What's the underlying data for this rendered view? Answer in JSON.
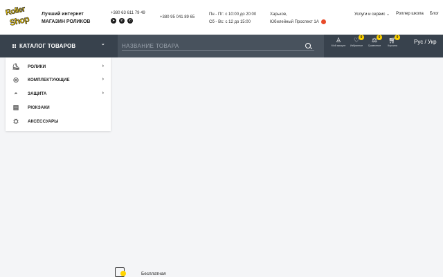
{
  "header": {
    "logo_line1": "Roller",
    "logo_line2": "Shop",
    "tagline_line1": "Лучший интернет",
    "tagline_line2": "МАГАЗИН РОЛИКОВ",
    "phone_primary": "+380 63 611 79 49",
    "phone_secondary": "+380 95 041 89 65",
    "hours_weekdays": "Пн - Пт: с 10:00 до 20:00",
    "hours_weekend": "Сб - Вс: с 12 до 15:00",
    "address_city": "Харьков,",
    "address_street": "Юбилейный Проспект 1А",
    "nav": {
      "services": "Услуги и сервис",
      "school": "Роллер школа",
      "blog": "Блог"
    },
    "messenger_icons": [
      "telegram-icon",
      "viber-icon",
      "whatsapp-icon"
    ]
  },
  "bar": {
    "catalog_label": "КАТАЛОГ ТОВАРОВ",
    "search_placeholder": "НАЗВАНИЕ ТОВАРА",
    "account_label": "Мой аккаунт",
    "favorites_label": "Избранное",
    "favorites_count": "0",
    "compare_label": "Сравнение",
    "compare_count": "0",
    "cart_label": "Корзина",
    "cart_count": "0",
    "language": "Рус / Укр"
  },
  "catalog_menu": {
    "items": [
      {
        "label": "РОЛИКИ",
        "icon": "skate-icon",
        "has_submenu": true
      },
      {
        "label": "КОМПЛЕКТУЮЩИЕ",
        "icon": "wheel-icon",
        "has_submenu": true
      },
      {
        "label": "ЗАЩИТА",
        "icon": "helmet-icon",
        "has_submenu": true
      },
      {
        "label": "РЮКЗАКИ",
        "icon": "backpack-icon",
        "has_submenu": false
      },
      {
        "label": "АКСЕССУАРЫ",
        "icon": "accessories-icon",
        "has_submenu": false
      }
    ]
  },
  "promo": {
    "text": "Бесплатная"
  },
  "colors": {
    "brand_yellow": "#ffd400",
    "dark_bar": "#38424d",
    "search_bg": "#48525d",
    "background": "#f4f5f7"
  }
}
